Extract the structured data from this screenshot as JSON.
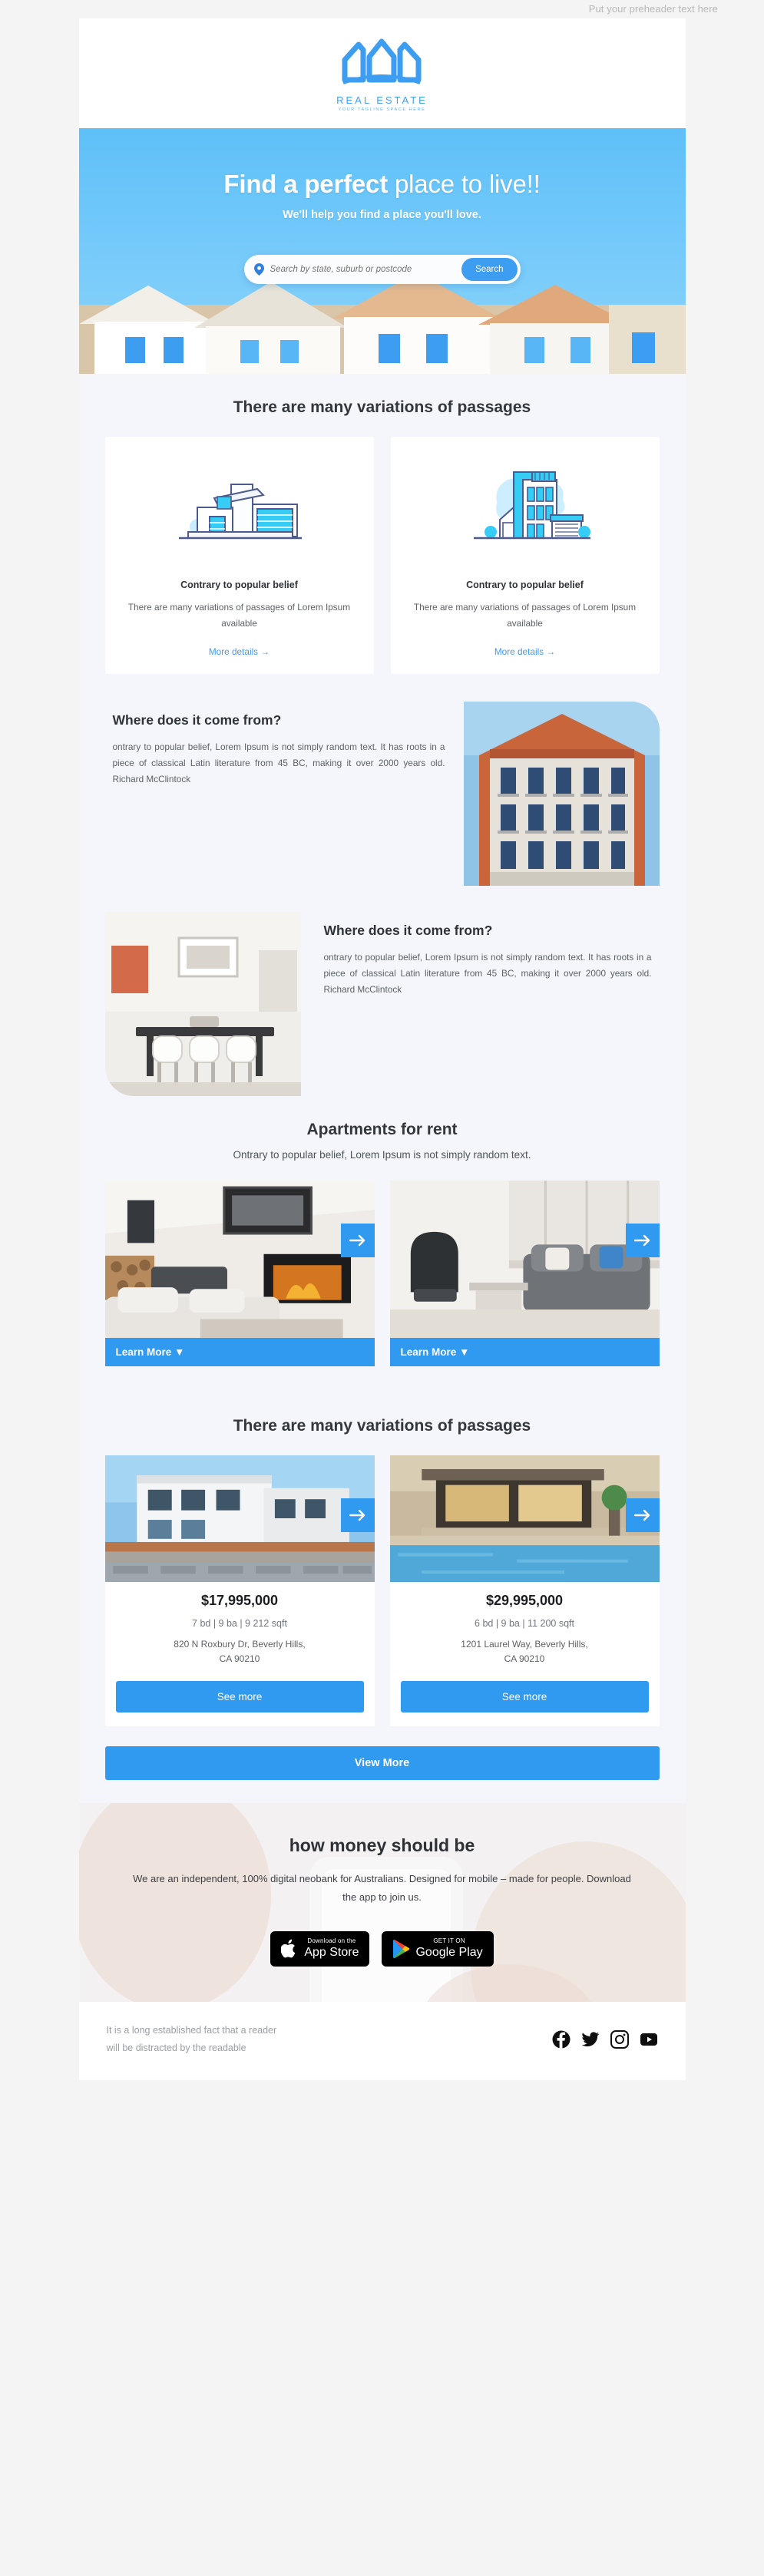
{
  "preheader": "Put your preheader text here",
  "brand": {
    "name": "REAL ESTATE",
    "tagline": "YOUR TAGLINE SPACE HERE",
    "accent": "#3d9df0"
  },
  "hero": {
    "title_bold": "Find a perfect",
    "title_rest": " place to live!!",
    "subtitle": "We'll help you find a place you'll love.",
    "search_placeholder": "Search by state, suburb or postcode",
    "search_value": "",
    "search_button": "Search"
  },
  "features": {
    "heading": "There are many variations of passages",
    "cards": [
      {
        "illustration": "modern-house-illustration",
        "title": "Contrary to popular belief",
        "text": "There are many variations of passages of Lorem Ipsum available",
        "link": "More details →"
      },
      {
        "illustration": "apartment-building-illustration",
        "title": "Contrary to popular belief",
        "text": "There are many variations of passages of Lorem Ipsum available",
        "link": "More details →"
      }
    ]
  },
  "about": [
    {
      "heading": "Where does it come from?",
      "text": "ontrary to popular belief, Lorem Ipsum is not simply random text. It has roots in a piece of classical Latin literature from 45 BC, making it over 2000 years old. Richard McClintock",
      "image": "paris-haussmann-building-photo"
    },
    {
      "heading": "Where does it come from?",
      "text": "ontrary to popular belief, Lorem Ipsum is not simply random text. It has roots in a piece of classical Latin literature from 45 BC, making it over 2000 years old. Richard McClintock",
      "image": "modern-dining-room-photo"
    }
  ],
  "apartments": {
    "heading": "Apartments for rent",
    "subheading": "Ontrary to popular belief, Lorem Ipsum is not simply random text.",
    "items": [
      {
        "image": "living-room-with-fireplace-photo",
        "cta": "Learn More ▼"
      },
      {
        "image": "grey-sofa-lounge-photo",
        "cta": "Learn More ▼"
      }
    ]
  },
  "listings": {
    "heading": "There are many variations of passages",
    "items": [
      {
        "image": "white-modern-villa-photo",
        "price": "$17,995,000",
        "specs": "7 bd | 9 ba | 9 212 sqft",
        "address_line1": "820 N Roxbury Dr, Beverly Hills,",
        "address_line2": "CA 90210",
        "cta": "See more"
      },
      {
        "image": "poolside-modern-house-photo",
        "price": "$29,995,000",
        "specs": "6 bd | 9 ba | 11 200 sqft",
        "address_line1": "1201 Laurel Way, Beverly Hills,",
        "address_line2": "CA 90210",
        "cta": "See more"
      }
    ],
    "view_more": "View More"
  },
  "cta": {
    "heading": "how money should be",
    "text": "We are an independent, 100% digital neobank for Australians. Designed for mobile – made for people. Download the app to join us.",
    "badges": [
      {
        "small": "Download on the",
        "big": "App Store",
        "icon": "apple-icon"
      },
      {
        "small": "GET IT ON",
        "big": "Google Play",
        "icon": "google-play-icon"
      }
    ]
  },
  "footer": {
    "text_line1": "It is a long established fact that a reader",
    "text_line2": "will be distracted by the readable",
    "social": [
      {
        "name": "facebook-icon"
      },
      {
        "name": "twitter-icon"
      },
      {
        "name": "instagram-icon"
      },
      {
        "name": "youtube-icon"
      }
    ]
  }
}
